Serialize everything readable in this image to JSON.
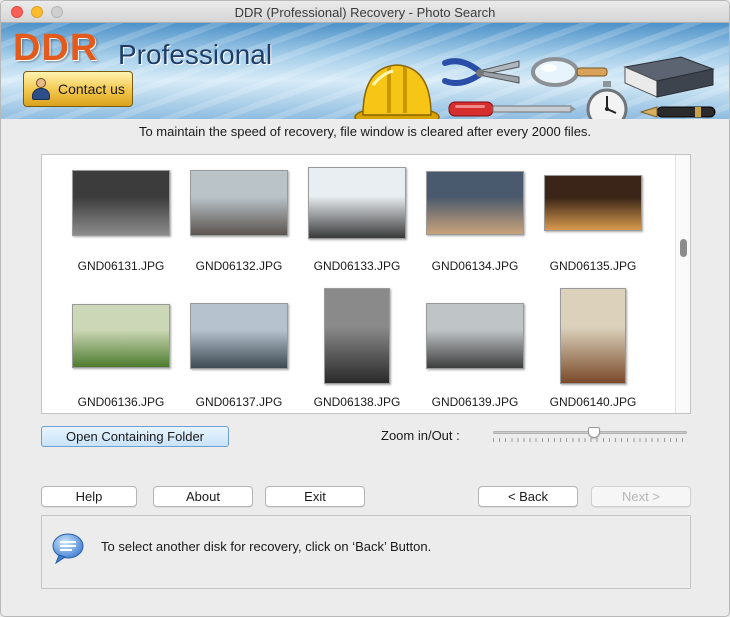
{
  "window": {
    "title": "DDR (Professional) Recovery - Photo Search"
  },
  "banner": {
    "brand_main": "DDR",
    "brand_sub": "Professional",
    "contact_label": "Contact us"
  },
  "info_text": "To maintain the speed of recovery, file window is cleared after every 2000 files.",
  "files": [
    {
      "name": "GND06131.JPG",
      "colors": [
        "#3c3c3c",
        "#8c8c8c"
      ]
    },
    {
      "name": "GND06132.JPG",
      "colors": [
        "#b9c3c8",
        "#5c5450"
      ]
    },
    {
      "name": "GND06133.JPG",
      "colors": [
        "#e9eef2",
        "#3a3a3a"
      ]
    },
    {
      "name": "GND06134.JPG",
      "colors": [
        "#4a5a6e",
        "#c9a27a"
      ]
    },
    {
      "name": "GND06135.JPG",
      "colors": [
        "#3a2518",
        "#d89a4e"
      ]
    },
    {
      "name": "GND06136.JPG",
      "colors": [
        "#cbd7b6",
        "#4d7b2e"
      ]
    },
    {
      "name": "GND06137.JPG",
      "colors": [
        "#b6c3cf",
        "#3d4a52"
      ]
    },
    {
      "name": "GND06138.JPG",
      "colors": [
        "#8a8a8a",
        "#2a2a2a"
      ]
    },
    {
      "name": "GND06139.JPG",
      "colors": [
        "#bfc4c6",
        "#3e3e3e"
      ]
    },
    {
      "name": "GND06140.JPG",
      "colors": [
        "#dcd2bc",
        "#7a4a2a"
      ]
    }
  ],
  "controls": {
    "open_folder_label": "Open Containing Folder",
    "zoom_label": "Zoom in/Out :",
    "zoom_level": 0.52
  },
  "buttons": {
    "help": "Help",
    "about": "About",
    "exit": "Exit",
    "back": "< Back",
    "next": "Next >"
  },
  "message": "To select another disk for recovery, click on ‘Back’ Button."
}
